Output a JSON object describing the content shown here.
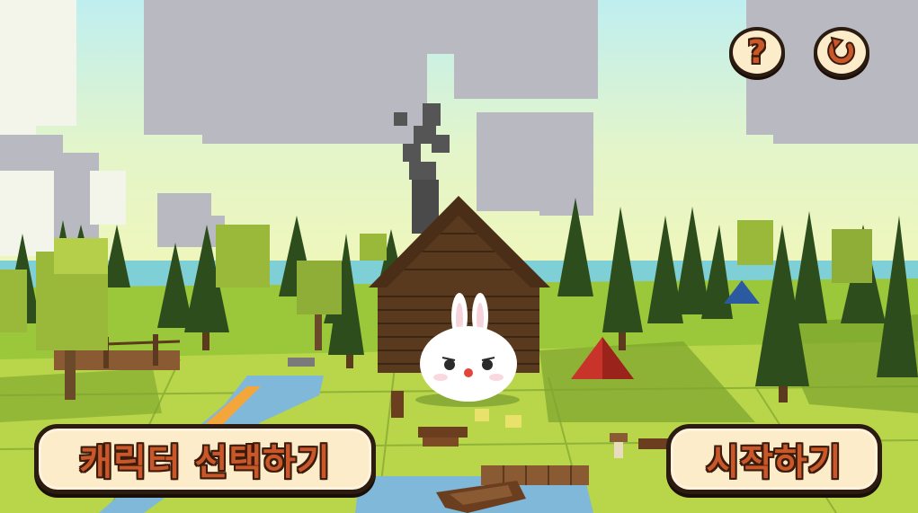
{
  "buttons": {
    "help_label": "?",
    "character_select_label": "캐릭터 선택하기",
    "start_label": "시작하기"
  },
  "icons": {
    "help": "question-mark-icon",
    "reset": "refresh-icon"
  },
  "colors": {
    "button_fill": "#fdecc9",
    "button_text": "#c9572a",
    "button_outline": "#2b1b10"
  }
}
